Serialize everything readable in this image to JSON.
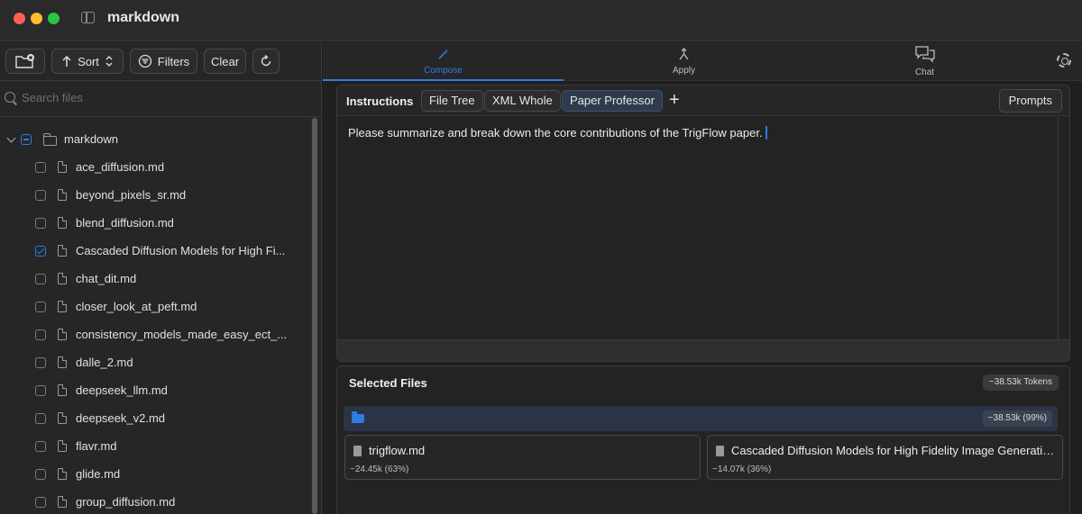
{
  "window": {
    "title": "markdown"
  },
  "toolbar": {
    "sort_label": "Sort",
    "filters_label": "Filters",
    "clear_label": "Clear"
  },
  "search": {
    "placeholder": "Search files"
  },
  "tree": {
    "root": {
      "label": "markdown",
      "state": "partial"
    },
    "items": [
      {
        "label": "ace_diffusion.md",
        "checked": false
      },
      {
        "label": "beyond_pixels_sr.md",
        "checked": false
      },
      {
        "label": "blend_diffusion.md",
        "checked": false
      },
      {
        "label": "Cascaded Diffusion Models for High Fi...",
        "checked": true
      },
      {
        "label": "chat_dit.md",
        "checked": false
      },
      {
        "label": "closer_look_at_peft.md",
        "checked": false
      },
      {
        "label": "consistency_models_made_easy_ect_...",
        "checked": false
      },
      {
        "label": "dalle_2.md",
        "checked": false
      },
      {
        "label": "deepseek_llm.md",
        "checked": false
      },
      {
        "label": "deepseek_v2.md",
        "checked": false
      },
      {
        "label": "flavr.md",
        "checked": false
      },
      {
        "label": "glide.md",
        "checked": false
      },
      {
        "label": "group_diffusion.md",
        "checked": false
      }
    ]
  },
  "modes": [
    {
      "label": "Compose",
      "icon": "pencil-icon",
      "active": true
    },
    {
      "label": "Apply",
      "icon": "merge-icon",
      "active": false
    },
    {
      "label": "Chat",
      "icon": "chat-bubbles-icon",
      "active": false
    }
  ],
  "instructions": {
    "title": "Instructions",
    "tabs": [
      "File Tree",
      "XML Whole",
      "Paper Professor"
    ],
    "active_tab": "Paper Professor",
    "prompts_label": "Prompts",
    "text": "Please summarize and break down the core contributions of the TrigFlow paper."
  },
  "selected_files": {
    "title": "Selected Files",
    "total_tokens": "~38.53k Tokens",
    "folder_tokens": "~38.53k (99%)",
    "files": [
      {
        "name": "trigflow.md",
        "tokens": "~24.45k (63%)"
      },
      {
        "name": "Cascaded Diffusion Models for High Fidelity Image Generation.md",
        "tokens": "~14.07k (36%)"
      }
    ]
  },
  "colors": {
    "accent": "#2f7be0"
  }
}
